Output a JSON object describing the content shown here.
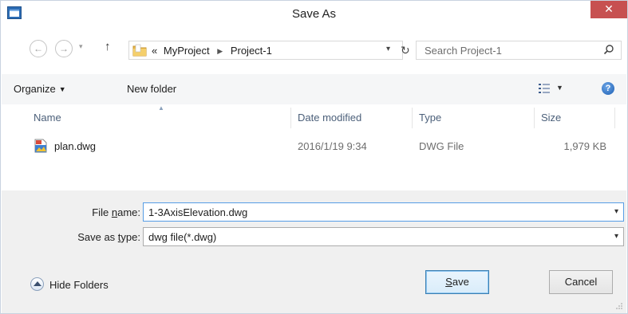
{
  "window": {
    "title": "Save As",
    "close_glyph": "✕"
  },
  "nav": {
    "back_glyph": "←",
    "forward_glyph": "→",
    "recent_glyph": "▾",
    "up_glyph": "↑",
    "breadcrumb_prefix": "«",
    "breadcrumb": [
      "MyProject",
      "Project-1"
    ],
    "address_dropdown_glyph": "▾",
    "refresh_glyph": "↻",
    "search_placeholder": "Search Project-1"
  },
  "toolbar": {
    "organize_label": "Organize",
    "organize_caret": "▼",
    "new_folder_label": "New folder",
    "view_caret": "▼",
    "help_glyph": "?"
  },
  "columns": {
    "sort_glyph": "▲",
    "name": "Name",
    "date_modified": "Date modified",
    "type": "Type",
    "size": "Size"
  },
  "files": [
    {
      "name": "plan.dwg",
      "date_modified": "2016/1/19 9:34",
      "type": "DWG File",
      "size": "1,979 KB",
      "icon": "dwg-file-icon"
    }
  ],
  "form": {
    "file_name_label_pre": "File ",
    "file_name_label_u": "n",
    "file_name_label_post": "ame:",
    "file_name_value": "1-3AxisElevation.dwg",
    "save_type_label_pre": "Save as ",
    "save_type_label_u": "t",
    "save_type_label_post": "ype:",
    "save_type_value": "dwg file(*.dwg)",
    "dropdown_glyph": "▾"
  },
  "footer": {
    "hide_folders_label": "Hide Folders",
    "save_label_u": "S",
    "save_label_rest": "ave",
    "cancel_label": "Cancel"
  },
  "colors": {
    "close_button": "#c75050",
    "toolbar_bg": "#f5f6f7",
    "bottom_panel_bg": "#f0f0f0",
    "header_text": "#4c607a",
    "default_button_border": "#3c7fb1"
  }
}
